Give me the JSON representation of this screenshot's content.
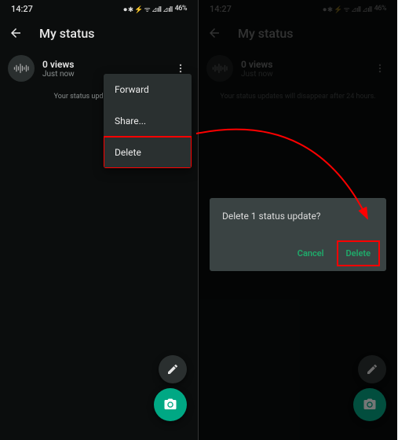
{
  "statusbar": {
    "time": "14:27",
    "battery": "46%",
    "icons_text": "⏺ ✱ ⚡ ᯤ ⊿ıll ⊿ıll"
  },
  "appbar": {
    "title": "My status"
  },
  "status": {
    "views": "0 views",
    "time": "Just now"
  },
  "expiry": {
    "left_truncated": "Your status updates will disa",
    "full": "Your status updates will disappear after 24 hours."
  },
  "menu": {
    "forward": "Forward",
    "share": "Share...",
    "delete": "Delete"
  },
  "dialog": {
    "title": "Delete 1 status update?",
    "cancel": "Cancel",
    "confirm": "Delete"
  }
}
